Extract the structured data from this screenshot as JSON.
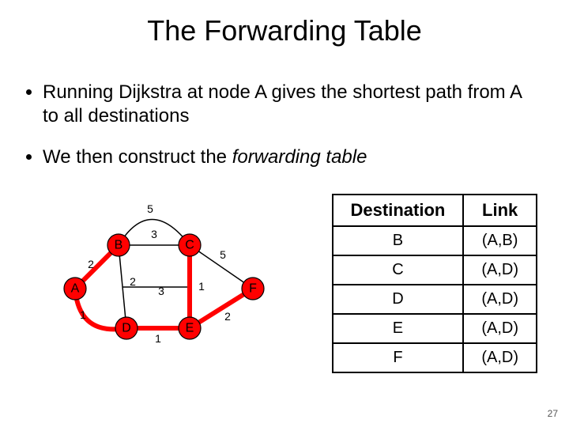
{
  "title": "The Forwarding Table",
  "bullets": [
    "Running Dijkstra at node A gives the shortest path from A to all destinations",
    "We then construct the "
  ],
  "bullet2_italic": "forwarding table",
  "table": {
    "headers": [
      "Destination",
      "Link"
    ],
    "rows": [
      [
        "B",
        "(A,B)"
      ],
      [
        "C",
        "(A,D)"
      ],
      [
        "D",
        "(A,D)"
      ],
      [
        "E",
        "(A,D)"
      ],
      [
        "F",
        "(A,D)"
      ]
    ]
  },
  "graph": {
    "nodes": {
      "A": "A",
      "B": "B",
      "C": "C",
      "D": "D",
      "E": "E",
      "F": "F"
    },
    "weights": {
      "BC_top": "5",
      "AB": "2",
      "BC": "3",
      "AD_curve": "1",
      "BD": "2",
      "CE_cf_mid": "3",
      "CE_1": "1",
      "CF": "5",
      "DE": "1",
      "EF": "2"
    }
  },
  "pagenum": "27"
}
